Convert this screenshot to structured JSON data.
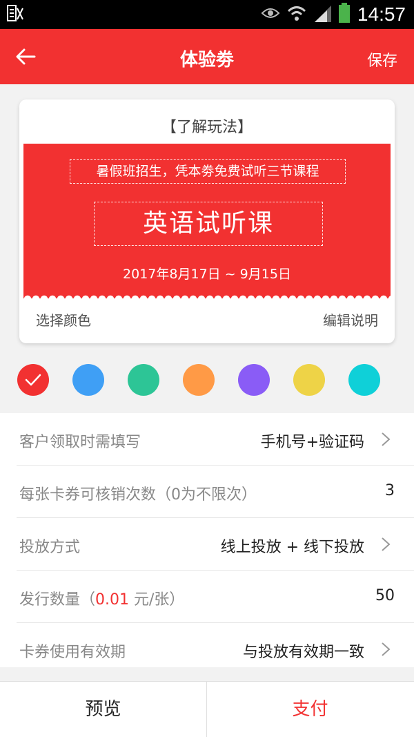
{
  "status_bar": {
    "time": "14:57",
    "icons": [
      "app-notification-icon",
      "eye-icon",
      "wifi-icon",
      "signal-icon",
      "battery-icon"
    ]
  },
  "app_bar": {
    "title": "体验劵",
    "save_label": "保存",
    "background": "#f23131"
  },
  "coupon_card": {
    "howto_label": "【了解玩法】",
    "subtitle": "暑假班招生，凭本劵免费试听三节课程",
    "main_title": "英语试听课",
    "date_range": "2017年8月17日 ~ 9月15日",
    "choose_color_label": "选择颜色",
    "edit_desc_label": "编辑说明",
    "coupon_color": "#f23131"
  },
  "color_options": [
    {
      "name": "red",
      "hex": "#f23131",
      "selected": true
    },
    {
      "name": "blue",
      "hex": "#3f9ff5",
      "selected": false
    },
    {
      "name": "green",
      "hex": "#2dc596",
      "selected": false
    },
    {
      "name": "orange",
      "hex": "#ff9a46",
      "selected": false
    },
    {
      "name": "purple",
      "hex": "#8a5cf6",
      "selected": false
    },
    {
      "name": "yellow",
      "hex": "#eed347",
      "selected": false
    },
    {
      "name": "cyan",
      "hex": "#0fd0d8",
      "selected": false
    }
  ],
  "settings": {
    "required_info": {
      "label": "客户领取时需填写",
      "value": "手机号+验证码"
    },
    "redeem_count": {
      "label": "每张卡券可核销次数（0为不限次）",
      "value": "3"
    },
    "delivery_method": {
      "label": "投放方式",
      "value": "线上投放 + 线下投放"
    },
    "issue_quantity": {
      "label_prefix": "发行数量（",
      "price": "0.01",
      "label_suffix": " 元/张）",
      "value": "50"
    },
    "validity": {
      "label": "卡券使用有效期",
      "value": "与投放有效期一致"
    }
  },
  "bottom_bar": {
    "preview_label": "预览",
    "pay_label": "支付"
  }
}
